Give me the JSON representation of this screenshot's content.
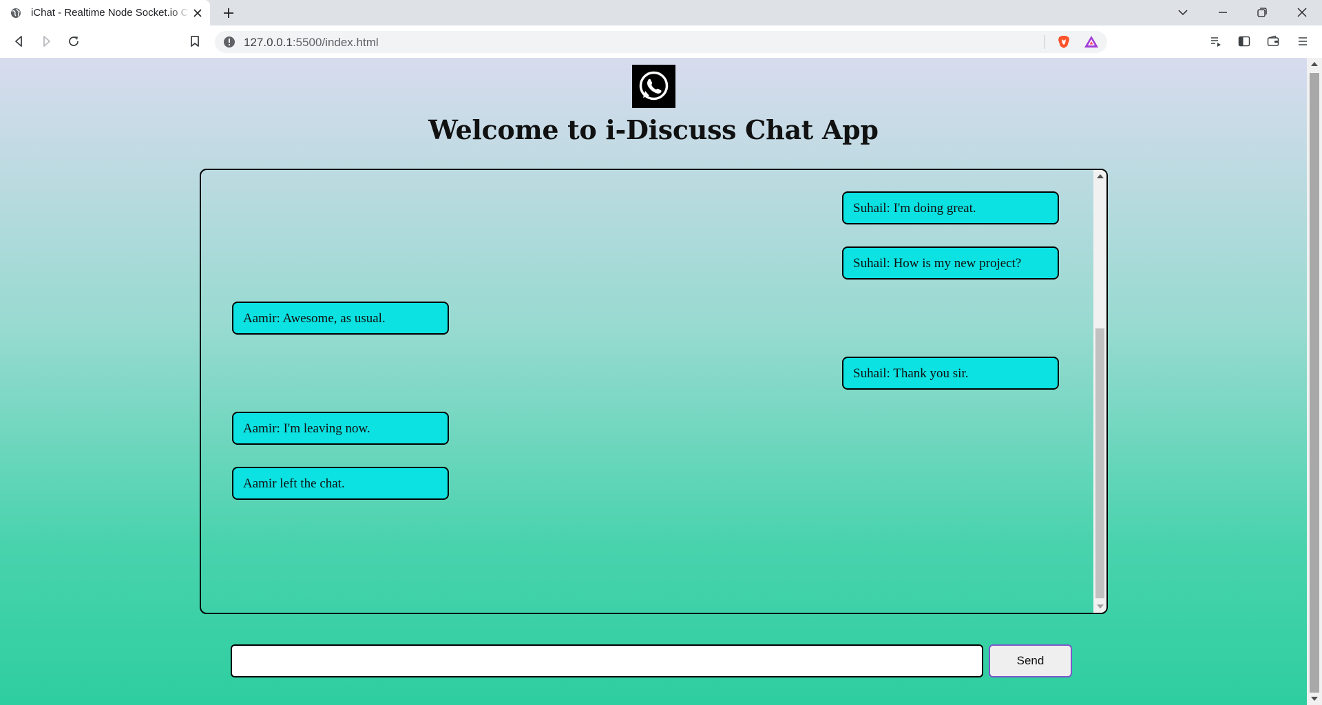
{
  "browser": {
    "tab_title": "iChat - Realtime Node Socket.io Chat",
    "url_host": "127.0.0.1",
    "url_rest": ":5500/index.html"
  },
  "page": {
    "title": "Welcome to i-Discuss Chat App",
    "message_input_value": "",
    "send_label": "Send"
  },
  "messages": [
    {
      "side": "right",
      "text": "Suhail: I'm doing great."
    },
    {
      "side": "right",
      "text": "Suhail: How is my new project?"
    },
    {
      "side": "left",
      "text": "Aamir: Awesome, as usual."
    },
    {
      "side": "right",
      "text": "Suhail: Thank you sir."
    },
    {
      "side": "left",
      "text": "Aamir: I'm leaving now."
    },
    {
      "side": "left",
      "text": "Aamir left the chat."
    }
  ],
  "colors": {
    "message_bubble": "#0ce2e2",
    "gradient_top": "#d8dbee",
    "gradient_bottom": "#2ecea0",
    "send_border": "#7b57c9"
  },
  "icons": {
    "logo": "whatsapp-icon",
    "brave": "brave-shield-icon",
    "rewards": "brave-rewards-icon"
  }
}
